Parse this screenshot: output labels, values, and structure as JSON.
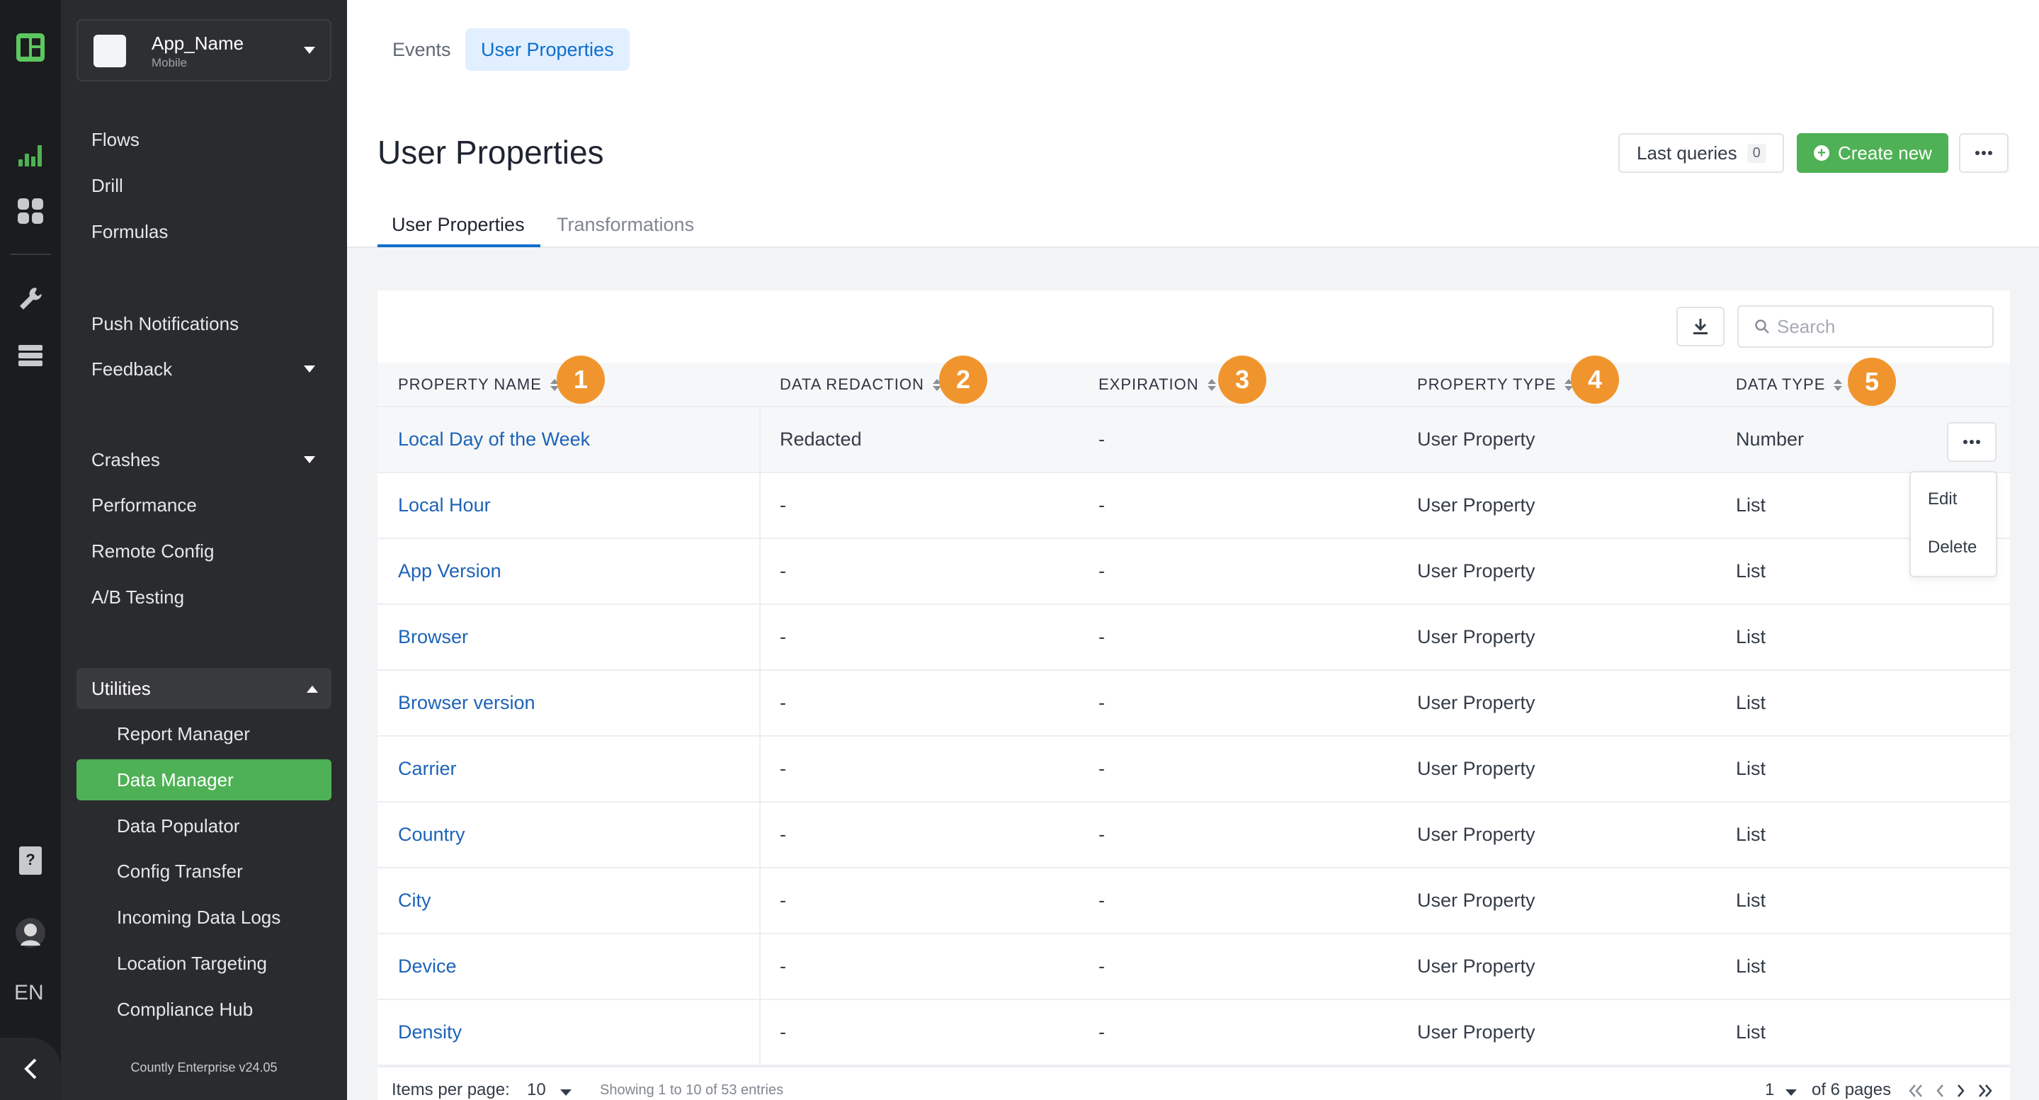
{
  "app": {
    "name": "App_Name",
    "platform": "Mobile",
    "version_label": "Countly Enterprise v24.05",
    "language": "EN"
  },
  "sidebar": {
    "items": [
      {
        "label": "Flows"
      },
      {
        "label": "Drill"
      },
      {
        "label": "Formulas"
      },
      {
        "label": "Push Notifications"
      },
      {
        "label": "Feedback"
      },
      {
        "label": "Crashes"
      },
      {
        "label": "Performance"
      },
      {
        "label": "Remote Config"
      },
      {
        "label": "A/B Testing"
      }
    ],
    "utilities": {
      "label": "Utilities",
      "items": [
        {
          "label": "Report Manager"
        },
        {
          "label": "Data Manager"
        },
        {
          "label": "Data Populator"
        },
        {
          "label": "Config Transfer"
        },
        {
          "label": "Incoming Data Logs"
        },
        {
          "label": "Location Targeting"
        },
        {
          "label": "Compliance Hub"
        }
      ],
      "active": "Data Manager"
    }
  },
  "top_tabs": [
    "Events",
    "User Properties"
  ],
  "page": {
    "title": "User Properties",
    "last_queries_label": "Last queries",
    "last_queries_count": "0",
    "create_new_label": "Create new"
  },
  "sub_tabs": [
    "User Properties",
    "Transformations"
  ],
  "search": {
    "placeholder": "Search"
  },
  "table": {
    "columns": [
      "PROPERTY NAME",
      "DATA REDACTION",
      "EXPIRATION",
      "PROPERTY TYPE",
      "DATA TYPE"
    ],
    "badges": [
      "1",
      "2",
      "3",
      "4",
      "5"
    ],
    "rows": [
      [
        "Local Day of the Week",
        "Redacted",
        "-",
        "User Property",
        "Number"
      ],
      [
        "Local Hour",
        "-",
        "-",
        "User Property",
        "List"
      ],
      [
        "App Version",
        "-",
        "-",
        "User Property",
        "List"
      ],
      [
        "Browser",
        "-",
        "-",
        "User Property",
        "List"
      ],
      [
        "Browser version",
        "-",
        "-",
        "User Property",
        "List"
      ],
      [
        "Carrier",
        "-",
        "-",
        "User Property",
        "List"
      ],
      [
        "Country",
        "-",
        "-",
        "User Property",
        "List"
      ],
      [
        "City",
        "-",
        "-",
        "User Property",
        "List"
      ],
      [
        "Device",
        "-",
        "-",
        "User Property",
        "List"
      ],
      [
        "Density",
        "-",
        "-",
        "User Property",
        "List"
      ]
    ],
    "row_menu": [
      "Edit",
      "Delete"
    ]
  },
  "footer": {
    "items_per_page_label": "Items per page:",
    "items_per_page_value": "10",
    "showing": "Showing 1 to 10 of 53 entries",
    "current_page": "1",
    "pages_label": "of 6 pages"
  },
  "colors": {
    "accent_green": "#4eb155",
    "link_blue": "#1d63b8",
    "badge_orange": "#f0952d",
    "sidebar_bg": "#2a2b2e",
    "rail_bg": "#1b1c1e"
  },
  "icons": [
    "countly-logo-icon",
    "analytics-icon",
    "dashboards-icon",
    "wrench-icon",
    "database-icon",
    "help-icon",
    "avatar",
    "collapse-icon",
    "download-icon",
    "search-icon",
    "sort-icon",
    "more-icon"
  ]
}
